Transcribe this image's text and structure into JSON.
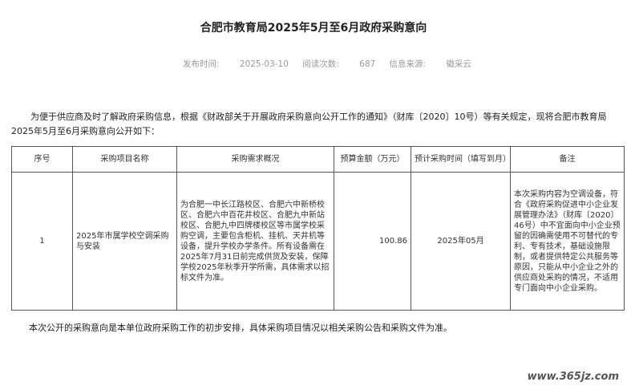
{
  "title": "合肥市教育局2025年5月至6月政府采购意向",
  "meta": {
    "publish_label": "发布时间:",
    "publish_date": "2025-03-10",
    "views_label": "阅读次数:",
    "views": "687",
    "source_label": "信息来源:",
    "source": "徽采云"
  },
  "intro": "为便于供应商及时了解政府采购信息，根据《财政部关于开展政府采购意向公开工作的通知》（财库〔2020〕10号）等有关规定，现将合肥市教育局2025年5月至6月采购意向公开如下：",
  "table": {
    "headers": [
      "序号",
      "采购项目名称",
      "采购需求概况",
      "预算金额（万元）",
      "预计采购时间（填写到月）",
      "备注"
    ],
    "rows": [
      {
        "no": "1",
        "name": "2025年市属学校空调采购与安装",
        "summary": "为合肥一中长江路校区、合肥六中新桥校区、合肥六中百花井校区、合肥九中新站校区、合肥九中四牌楼校区等市属学校采购空调，主要包含柜机、挂机、天井机等设备，提升学校办学条件。所有设备需在2025年7月31日前完成供货及安装，保障学校2025年秋季开学所需，具体需求以招标文件为准。",
        "budget": "100.86",
        "time": "2025年05月",
        "remark": "本次采购内容为空调设备，符合《政府采购促进中小企业发展管理办法》（财库〔2020〕46号）中不宜面向中小企业预留的因确需使用不可替代的专利、专有技术，基础设施限制，或者提供特定公共服务等原因，只能从中小企业之外的供应商处采购的情况，不适用专门面向中小企业采购。"
      }
    ]
  },
  "footer": "本次公开的采购意向是本单位政府采购工作的初步安排，具体采购项目情况以相关采购公告和采购文件为准。",
  "watermark": "www.365jz.com"
}
